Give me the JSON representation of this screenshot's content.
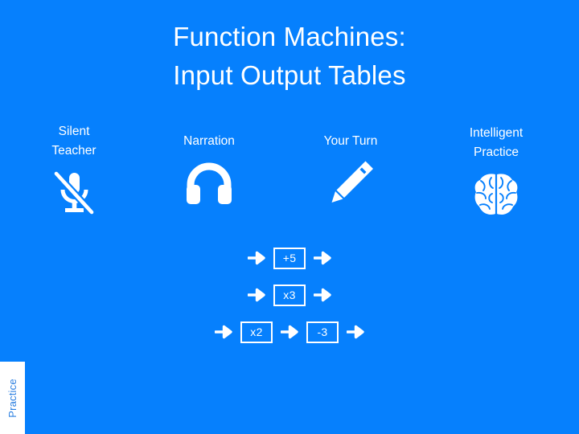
{
  "slide": {
    "background_color": "#0680fd",
    "text_color": "#ffffff",
    "title": {
      "line1": "Function Machines:",
      "line2": "Input Output Tables"
    }
  },
  "phases": [
    {
      "id": "silent",
      "label": "Silent\nTeacher",
      "icon": "microphone-muted-icon"
    },
    {
      "id": "narration",
      "label": "Narration",
      "icon": "headphones-icon"
    },
    {
      "id": "yourturn",
      "label": "Your Turn",
      "icon": "pencil-icon"
    },
    {
      "id": "practice",
      "label": "Intelligent\nPractice",
      "icon": "brain-icon"
    }
  ],
  "machines": {
    "rows": [
      {
        "operations": [
          "+5"
        ]
      },
      {
        "operations": [
          "x3"
        ]
      },
      {
        "operations": [
          "x2",
          "-3"
        ]
      }
    ],
    "arrow_glyph": "arrow-right-icon"
  },
  "practice_tab": {
    "label": "Practice",
    "background_color": "#ffffff",
    "text_color": "#2b7fe0"
  }
}
